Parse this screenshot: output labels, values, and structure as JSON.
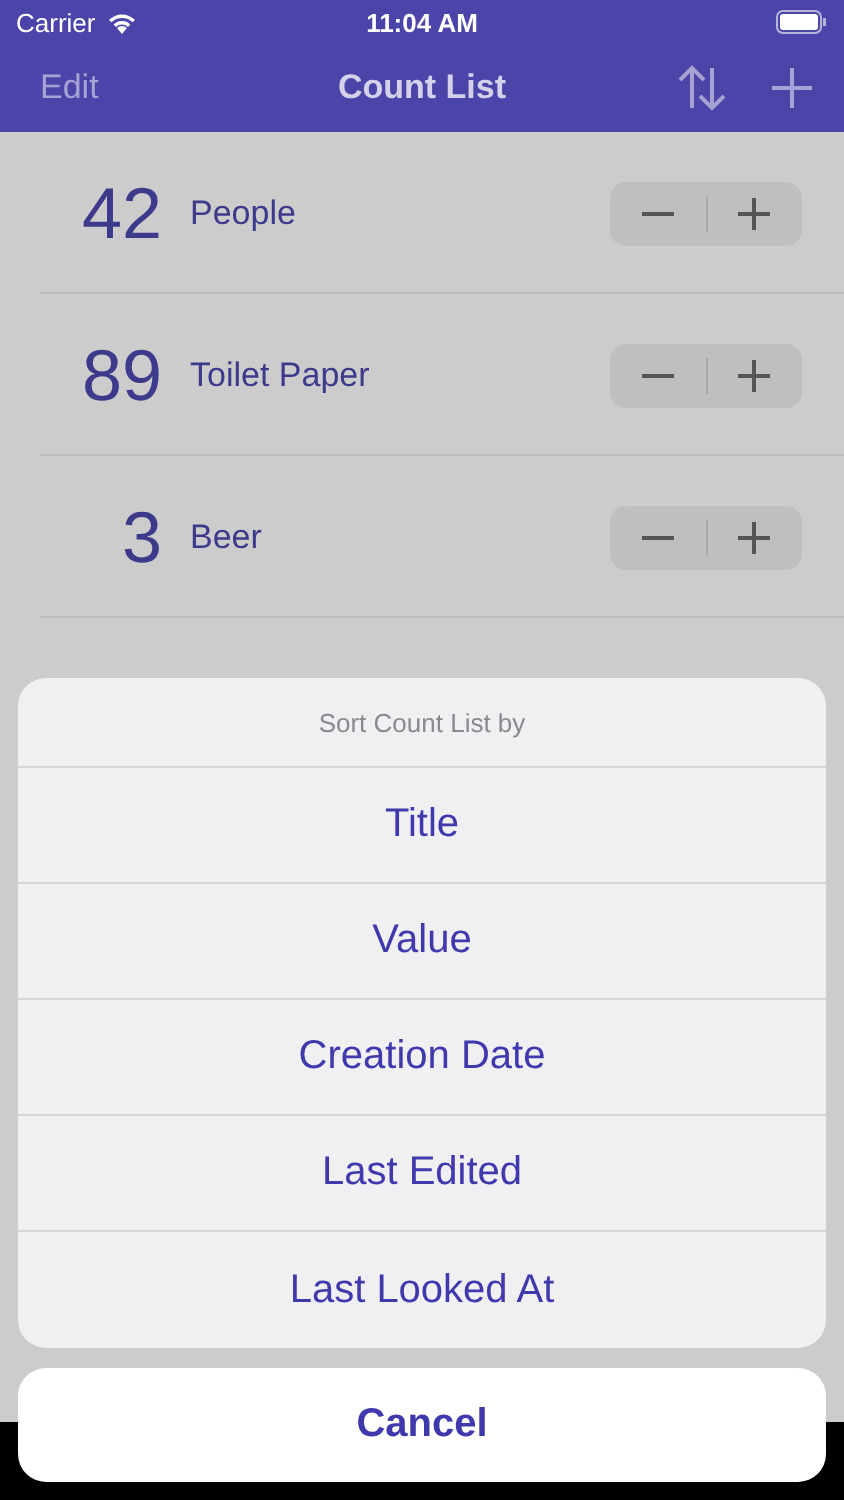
{
  "status_bar": {
    "carrier": "Carrier",
    "time": "11:04 AM"
  },
  "nav_bar": {
    "left": "Edit",
    "title": "Count List"
  },
  "rows": [
    {
      "value": "42",
      "title": "People"
    },
    {
      "value": "89",
      "title": "Toilet Paper"
    },
    {
      "value": "3",
      "title": "Beer"
    }
  ],
  "action_sheet": {
    "title": "Sort Count List by",
    "options": [
      "Title",
      "Value",
      "Creation Date",
      "Last Edited",
      "Last Looked At"
    ],
    "cancel": "Cancel"
  }
}
